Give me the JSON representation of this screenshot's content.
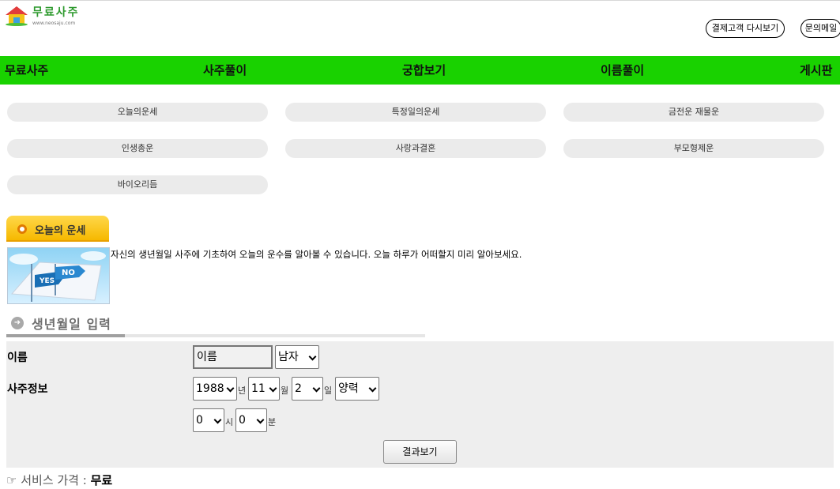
{
  "header": {
    "logo_title": "무료사주",
    "logo_url": "www.neosaju.com",
    "reorder_label": "결제고객 다시보기",
    "contact_label": "문의메일"
  },
  "nav": {
    "items": [
      "무료사주",
      "사주풀이",
      "궁합보기",
      "이름풀이",
      "게시판"
    ]
  },
  "submenu": {
    "items": [
      "오늘의운세",
      "특정일의운세",
      "금전운 재물운",
      "인생총운",
      "사랑과결혼",
      "부모형제운",
      "바이오리듬"
    ]
  },
  "section": {
    "tab_label": "오늘의 운세",
    "thumb_yes": "YES",
    "thumb_no": "NO",
    "description": "자신의 생년월일 사주에 기초하여 오늘의 운수를 알아볼 수 있습니다. 오늘 하루가 어떠할지 미리 알아보세요.",
    "input_heading": "생년월일 입력"
  },
  "form": {
    "name_label": "이름",
    "name_placeholder": "이름",
    "gender_value": "남자",
    "saju_label": "사주정보",
    "year_value": "1988",
    "year_unit": "년",
    "month_value": "11",
    "month_unit": "월",
    "day_value": "2",
    "day_unit": "일",
    "calendar_value": "양력",
    "hour_value": "0",
    "hour_unit": "시",
    "minute_value": "0",
    "minute_unit": "분",
    "submit_label": "결과보기"
  },
  "price": {
    "label": "☞ 서비스 가격 : ",
    "value": "무료"
  },
  "colors": {
    "nav_green": "#19d200",
    "logo_green": "#2e9a2e",
    "tab_yellow": "#f6b800"
  }
}
